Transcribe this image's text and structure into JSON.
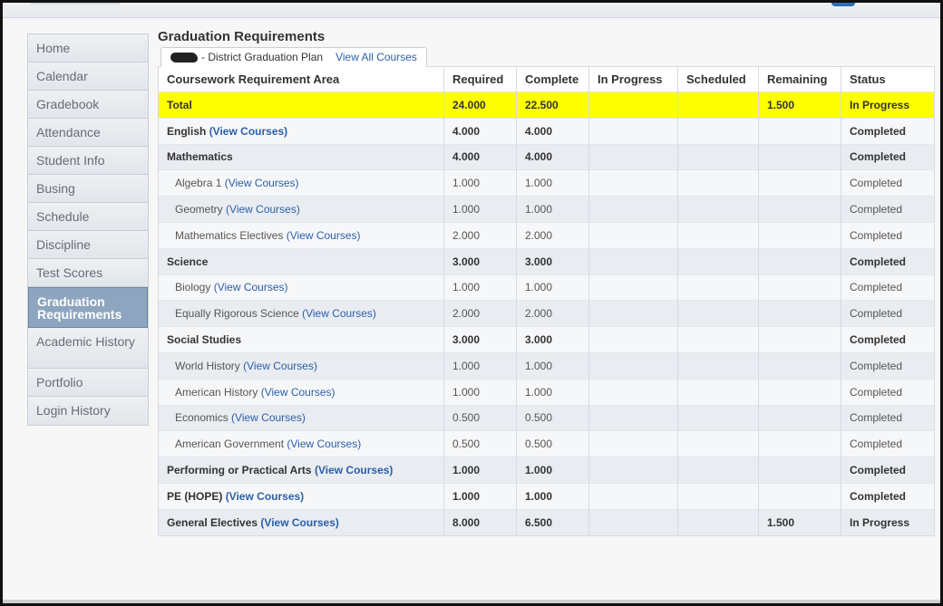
{
  "sidebar": {
    "items": [
      {
        "label": "Home",
        "active": false
      },
      {
        "label": "Calendar",
        "active": false
      },
      {
        "label": "Gradebook",
        "active": false
      },
      {
        "label": "Attendance",
        "active": false
      },
      {
        "label": "Student Info",
        "active": false
      },
      {
        "label": "Busing",
        "active": false
      },
      {
        "label": "Schedule",
        "active": false
      },
      {
        "label": "Discipline",
        "active": false
      },
      {
        "label": "Test Scores",
        "active": false
      },
      {
        "label": "Graduation Requirements",
        "active": true
      },
      {
        "label": "Academic History",
        "active": false
      },
      {
        "label": "Portfolio",
        "active": false
      },
      {
        "label": "Login History",
        "active": false
      }
    ]
  },
  "main": {
    "title": "Graduation Requirements",
    "tab": {
      "label": "- District Graduation Plan",
      "link": "View All Courses"
    },
    "columns": [
      "Coursework Requirement Area",
      "Required",
      "Complete",
      "In Progress",
      "Scheduled",
      "Remaining",
      "Status"
    ],
    "view_label": "(View Courses)",
    "rows": [
      {
        "area": "Total",
        "link": false,
        "indent": false,
        "required": "24.000",
        "complete": "22.500",
        "in_progress": "",
        "scheduled": "",
        "remaining": "1.500",
        "status": "In Progress"
      },
      {
        "area": "English",
        "link": true,
        "indent": false,
        "required": "4.000",
        "complete": "4.000",
        "in_progress": "",
        "scheduled": "",
        "remaining": "",
        "status": "Completed"
      },
      {
        "area": "Mathematics",
        "link": false,
        "indent": false,
        "required": "4.000",
        "complete": "4.000",
        "in_progress": "",
        "scheduled": "",
        "remaining": "",
        "status": "Completed"
      },
      {
        "area": "Algebra 1",
        "link": true,
        "indent": true,
        "required": "1.000",
        "complete": "1.000",
        "in_progress": "",
        "scheduled": "",
        "remaining": "",
        "status": "Completed"
      },
      {
        "area": "Geometry",
        "link": true,
        "indent": true,
        "required": "1.000",
        "complete": "1.000",
        "in_progress": "",
        "scheduled": "",
        "remaining": "",
        "status": "Completed"
      },
      {
        "area": "Mathematics Electives",
        "link": true,
        "indent": true,
        "required": "2.000",
        "complete": "2.000",
        "in_progress": "",
        "scheduled": "",
        "remaining": "",
        "status": "Completed"
      },
      {
        "area": "Science",
        "link": false,
        "indent": false,
        "required": "3.000",
        "complete": "3.000",
        "in_progress": "",
        "scheduled": "",
        "remaining": "",
        "status": "Completed"
      },
      {
        "area": "Biology",
        "link": true,
        "indent": true,
        "required": "1.000",
        "complete": "1.000",
        "in_progress": "",
        "scheduled": "",
        "remaining": "",
        "status": "Completed"
      },
      {
        "area": "Equally Rigorous Science",
        "link": true,
        "indent": true,
        "required": "2.000",
        "complete": "2.000",
        "in_progress": "",
        "scheduled": "",
        "remaining": "",
        "status": "Completed"
      },
      {
        "area": "Social Studies",
        "link": false,
        "indent": false,
        "required": "3.000",
        "complete": "3.000",
        "in_progress": "",
        "scheduled": "",
        "remaining": "",
        "status": "Completed"
      },
      {
        "area": "World History",
        "link": true,
        "indent": true,
        "required": "1.000",
        "complete": "1.000",
        "in_progress": "",
        "scheduled": "",
        "remaining": "",
        "status": "Completed"
      },
      {
        "area": "American History",
        "link": true,
        "indent": true,
        "required": "1.000",
        "complete": "1.000",
        "in_progress": "",
        "scheduled": "",
        "remaining": "",
        "status": "Completed"
      },
      {
        "area": "Economics",
        "link": true,
        "indent": true,
        "required": "0.500",
        "complete": "0.500",
        "in_progress": "",
        "scheduled": "",
        "remaining": "",
        "status": "Completed"
      },
      {
        "area": "American Government",
        "link": true,
        "indent": true,
        "required": "0.500",
        "complete": "0.500",
        "in_progress": "",
        "scheduled": "",
        "remaining": "",
        "status": "Completed"
      },
      {
        "area": "Performing or Practical Arts",
        "link": true,
        "indent": false,
        "required": "1.000",
        "complete": "1.000",
        "in_progress": "",
        "scheduled": "",
        "remaining": "",
        "status": "Completed"
      },
      {
        "area": "PE (HOPE)",
        "link": true,
        "indent": false,
        "required": "1.000",
        "complete": "1.000",
        "in_progress": "",
        "scheduled": "",
        "remaining": "",
        "status": "Completed"
      },
      {
        "area": "General Electives",
        "link": true,
        "indent": false,
        "required": "8.000",
        "complete": "6.500",
        "in_progress": "",
        "scheduled": "",
        "remaining": "1.500",
        "status": "In Progress"
      }
    ]
  },
  "colors": {
    "total_highlight": "#ffff00",
    "link": "#2b5fa8",
    "remaining_alert": "#d02020",
    "active_nav": "#8ea5bf"
  }
}
